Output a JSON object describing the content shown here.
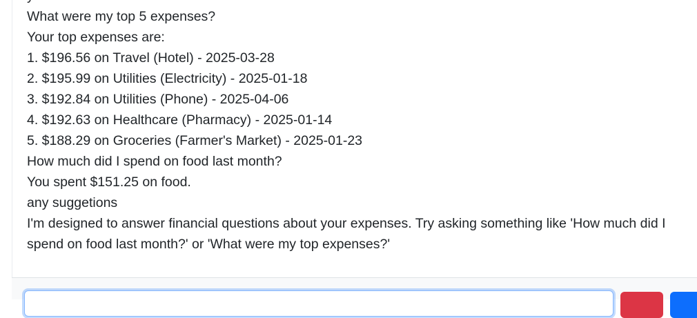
{
  "chat": {
    "messages": [
      {
        "role": "assistant",
        "text": "your financial data."
      },
      {
        "role": "user",
        "text": "What were my top 5 expenses?"
      },
      {
        "role": "assistant",
        "text": "Your top expenses are:"
      },
      {
        "role": "assistant",
        "text": "1. $196.56 on Travel (Hotel) - 2025-03-28"
      },
      {
        "role": "assistant",
        "text": "2. $195.99 on Utilities (Electricity) - 2025-01-18"
      },
      {
        "role": "assistant",
        "text": "3. $192.84 on Utilities (Phone) - 2025-04-06"
      },
      {
        "role": "assistant",
        "text": "4. $192.63 on Healthcare (Pharmacy) - 2025-01-14"
      },
      {
        "role": "assistant",
        "text": "5. $188.29 on Groceries (Farmer's Market) - 2025-01-23"
      },
      {
        "role": "user",
        "text": "How much did I spend on food last month?"
      },
      {
        "role": "assistant",
        "text": "You spent $151.25 on food."
      },
      {
        "role": "user",
        "text": "any suggetions"
      },
      {
        "role": "assistant",
        "text": "I'm designed to answer financial questions about your expenses. Try asking something like 'How much did I spend on food last month?' or 'What were my top expenses?'"
      }
    ]
  },
  "input": {
    "value": ""
  },
  "colors": {
    "clear_button": "#dc3545",
    "send_button": "#0d6efd",
    "input_focus_border": "#86b7fe"
  }
}
